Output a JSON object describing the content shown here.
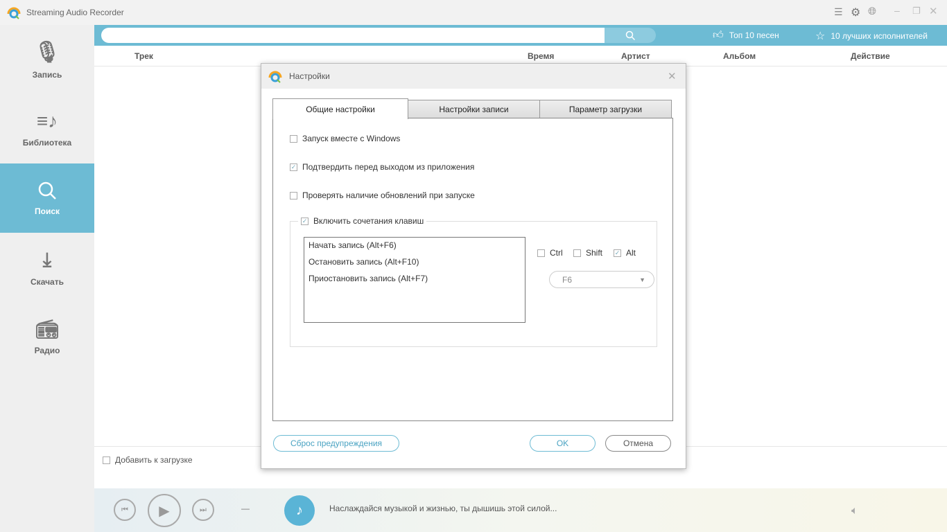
{
  "app": {
    "title": "Streaming Audio Recorder"
  },
  "sidebar": {
    "items": [
      {
        "label": "Запись"
      },
      {
        "label": "Библиотека"
      },
      {
        "label": "Поиск"
      },
      {
        "label": "Скачать"
      },
      {
        "label": "Радио"
      }
    ]
  },
  "topbar": {
    "search_placeholder": "",
    "top_songs": "Топ 10 песен",
    "top_artists": "10 лучших исполнителей"
  },
  "table": {
    "columns": [
      "Трек",
      "Время",
      "Артист",
      "Альбом",
      "Действие"
    ]
  },
  "footer": {
    "add_to_download": "Добавить к загрузке"
  },
  "player": {
    "message": "Наслаждайся музыкой и жизнью, ты дышишь этой силой...",
    "time": "—"
  },
  "dialog": {
    "title": "Настройки",
    "tabs": [
      "Общие настройки",
      "Настройки записи",
      "Параметр загрузки"
    ],
    "options": [
      {
        "label": "Запуск вместе с Windows",
        "checked": false
      },
      {
        "label": "Подтвердить перед выходом из приложения",
        "checked": true
      },
      {
        "label": "Проверять наличие обновлений при запуске",
        "checked": false
      }
    ],
    "hotkeys": {
      "label": "Включить сочетания клавиш",
      "checked": true,
      "items": [
        "Начать запись (Alt+F6)",
        "Остановить запись (Alt+F10)",
        "Приостановить запись (Alt+F7)"
      ],
      "modifiers": [
        {
          "label": "Ctrl",
          "checked": false
        },
        {
          "label": "Shift",
          "checked": false
        },
        {
          "label": "Alt",
          "checked": true
        }
      ],
      "key": "F6"
    },
    "reset_label": "Сброс предупреждения",
    "ok_label": "OK",
    "cancel_label": "Отмена"
  }
}
